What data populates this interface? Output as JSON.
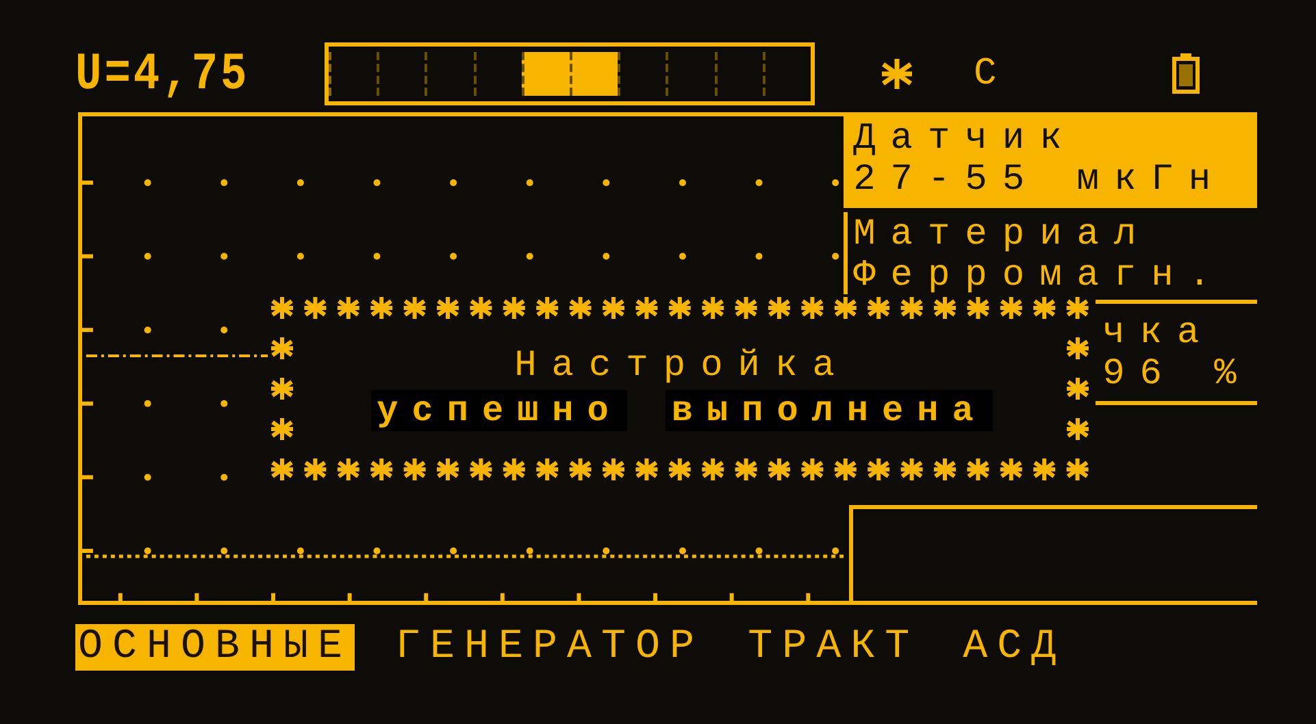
{
  "status_bar": {
    "voltage": "U=4,75",
    "range_segments": [
      {
        "selected": false
      },
      {
        "selected": false
      },
      {
        "selected": false
      },
      {
        "selected": false
      },
      {
        "selected": true
      },
      {
        "selected": true
      },
      {
        "selected": false
      },
      {
        "selected": false
      },
      {
        "selected": false
      },
      {
        "selected": false
      }
    ],
    "mode_letter": "С"
  },
  "panels": [
    {
      "label": "Датчик",
      "value": "27-55 мкГн",
      "selected": true
    },
    {
      "label": "Материал",
      "value": "Ферромагн.",
      "selected": false
    },
    {
      "label": "чка",
      "value": "96 %",
      "selected": false
    }
  ],
  "dialog": {
    "title": "Настройка",
    "message": [
      "успешно",
      "выполнена"
    ]
  },
  "tabs": [
    {
      "label": "ОСНОВНЫЕ",
      "selected": true
    },
    {
      "label": "ГЕНЕРАТОР",
      "selected": false
    },
    {
      "label": "ТРАКТ",
      "selected": false
    },
    {
      "label": "АСД",
      "selected": false
    }
  ]
}
